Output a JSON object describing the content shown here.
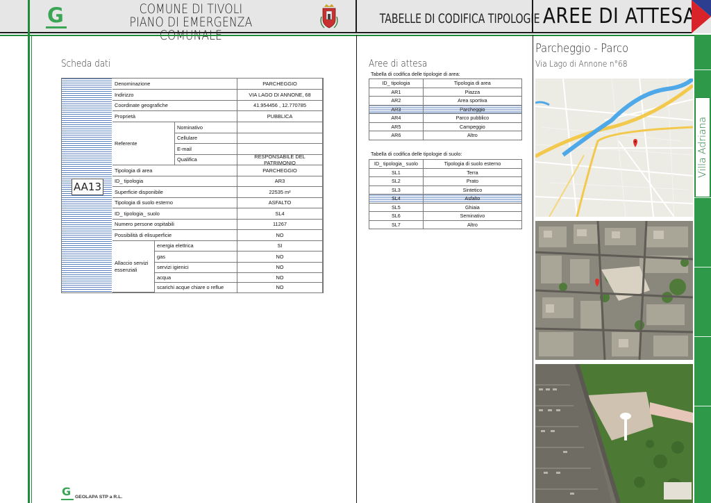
{
  "header": {
    "title_line1": "COMUNE DI TIVOLI",
    "title_line2": "PIANO DI EMERGENZA COMUNALE",
    "section": "TABELLE DI CODIFICA TIPOLOGIE",
    "page": "AREE DI ATTESA",
    "logo_letter": "G",
    "brand_color": "#3aa655"
  },
  "scheda": {
    "title": "Scheda dati",
    "code": "AA13",
    "rows": {
      "denominazione": {
        "label": "Denominazione",
        "value": "PARCHEGGIO"
      },
      "indirizzo": {
        "label": "Indirizzo",
        "value": "VIA LAGO DI ANNONE, 68"
      },
      "coordinate": {
        "label": "Coordinate geografiche",
        "value": "41.954456 , 12.770785"
      },
      "proprieta": {
        "label": "Proprietà",
        "value": "PUBBLICA"
      },
      "referente": {
        "label": "Referente",
        "nominativo": {
          "label": "Nominativo",
          "value": ""
        },
        "cellulare": {
          "label": "Cellulare",
          "value": ""
        },
        "email": {
          "label": "E-mail",
          "value": ""
        },
        "qualifica": {
          "label": "Qualifica",
          "value": "RESPONSABILE DEL PATRIMONIO"
        }
      },
      "tipologia_area": {
        "label": "Tipologia di area",
        "value": "PARCHEGGIO"
      },
      "id_tipologia": {
        "label": "ID_ tipologia",
        "value": "AR3"
      },
      "superficie": {
        "label": "Superficie disponibile",
        "value": "22535 m²"
      },
      "tipologia_suolo": {
        "label": "Tipologia di suolo esterno",
        "value": "ASFALTO"
      },
      "id_tipologia_suolo": {
        "label": "ID_ tipologia_ suolo",
        "value": "SL4"
      },
      "persone": {
        "label": "Numero persone ospitabili",
        "value": "11267"
      },
      "elisuperficie": {
        "label": "Possibilità di elisuperficie",
        "value": "NO"
      },
      "allaccio": {
        "label": "Allaccio servizi essenziali",
        "energia": {
          "label": "energia elettrica",
          "value": "SI"
        },
        "gas": {
          "label": "gas",
          "value": "NO"
        },
        "servizi": {
          "label": "servizi igienici",
          "value": "NO"
        },
        "acqua": {
          "label": "acqua",
          "value": "NO"
        },
        "scarichi": {
          "label": "scarichi acque chiare o reflue",
          "value": "NO"
        }
      }
    }
  },
  "codifica": {
    "title": "Aree di attesa",
    "area_caption": "Tabella di codifica delle tipologie di area:",
    "area_headers": [
      "ID_ tipologia",
      "Tipologia di area"
    ],
    "area_rows": [
      [
        "AR1",
        "Piazza"
      ],
      [
        "AR2",
        "Area sportiva"
      ],
      [
        "AR3",
        "Parcheggio"
      ],
      [
        "AR4",
        "Parco pubblico"
      ],
      [
        "AR5",
        "Campeggio"
      ],
      [
        "AR6",
        "Altro"
      ]
    ],
    "area_selected": "AR3",
    "suolo_caption": "Tabella di codifica delle tipologie di suolo:",
    "suolo_headers": [
      "ID_ tipologia_ suolo",
      "Tipologia di suolo esterno"
    ],
    "suolo_rows": [
      [
        "SL1",
        "Terra"
      ],
      [
        "SL2",
        "Prato"
      ],
      [
        "SL3",
        "Sintetico"
      ],
      [
        "SL4",
        "Asfalto"
      ],
      [
        "SL5",
        "Ghiaia"
      ],
      [
        "SL6",
        "Seminativo"
      ],
      [
        "SL7",
        "Altro"
      ]
    ],
    "suolo_selected": "SL4"
  },
  "location": {
    "name": "Parcheggio - Parco",
    "address": "Via Lago di Annone n°68",
    "district": "Villa Adriana"
  },
  "footer": {
    "company": "GEOLAPA STP  a R.L."
  }
}
